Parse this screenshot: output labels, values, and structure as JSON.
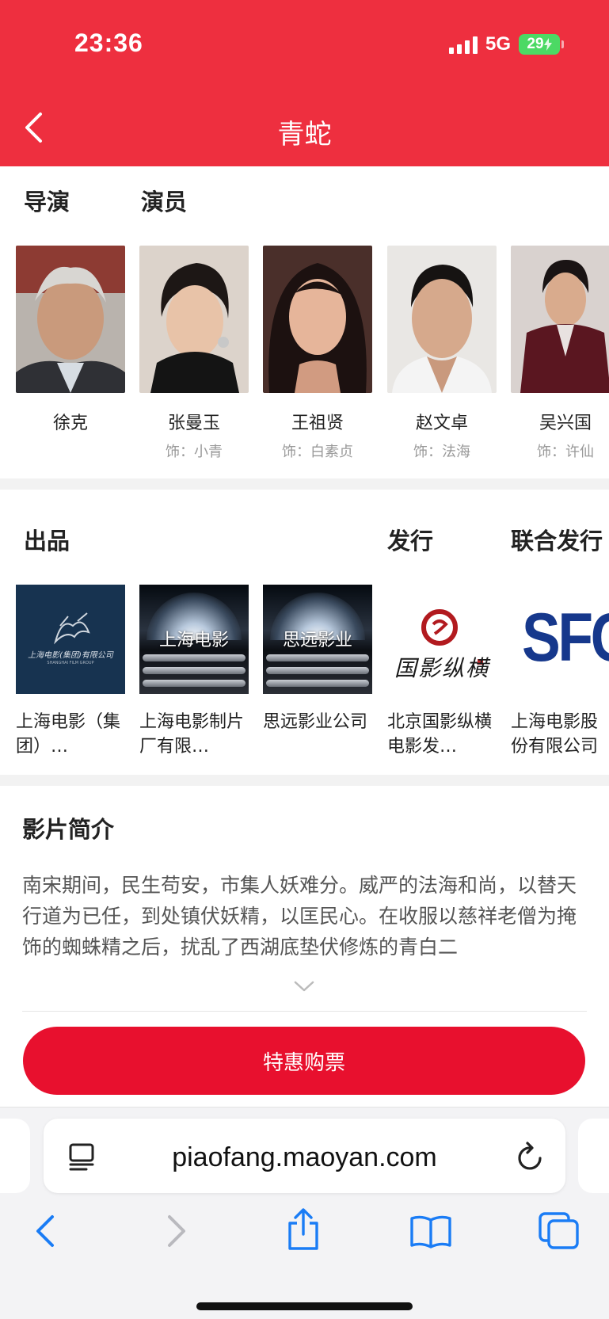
{
  "status_bar": {
    "time": "23:36",
    "network": "5G",
    "battery": "29"
  },
  "header": {
    "title": "青蛇"
  },
  "crew": {
    "tabs": [
      "导演",
      "演员"
    ],
    "people": [
      {
        "name": "徐克",
        "role": ""
      },
      {
        "name": "张曼玉",
        "role": "饰：小青"
      },
      {
        "name": "王祖贤",
        "role": "饰：白素贞"
      },
      {
        "name": "赵文卓",
        "role": "饰：法海"
      },
      {
        "name": "吴兴国",
        "role": "饰：许仙"
      }
    ]
  },
  "companies": {
    "headers": {
      "production": "出品",
      "distribution": "发行",
      "co_distribution": "联合发行"
    },
    "items": [
      {
        "name": "上海电影（集团）…",
        "logo_text": "上海电影(集团)有限公司",
        "logo_sub": "SHANGHAI FILM GROUP"
      },
      {
        "name": "上海电影制片厂有限…",
        "logo_text": "上海电影"
      },
      {
        "name": "思远影业公司",
        "logo_text": "思远影业"
      },
      {
        "name": "北京国影纵横电影发…",
        "logo_text": "国影纵横"
      },
      {
        "name": "上海电影股份有限公司",
        "logo_text": "SFC"
      }
    ]
  },
  "synopsis": {
    "title": "影片简介",
    "text": "南宋期间，民生苟安，市集人妖难分。威严的法海和尚，以替天行道为已任，到处镇伏妖精，以匡民心。在收服以慈祥老僧为掩饰的蜘蛛精之后，扰乱了西湖底垫伏修炼的青白二"
  },
  "buy_button": {
    "label": "特惠购票"
  },
  "browser": {
    "url": "piaofang.maoyan.com"
  },
  "icons": {
    "back": "chevron-left-icon",
    "expand": "chevron-down-icon",
    "reader": "reader-mode-icon",
    "reload": "reload-icon",
    "nav_back": "back-arrow-icon",
    "nav_forward": "forward-arrow-icon",
    "share": "share-icon",
    "bookmarks": "bookmarks-icon",
    "tabs": "tabs-icon"
  },
  "colors": {
    "header": "#ee2f3f",
    "buy_button": "#e8102e",
    "ios_blue": "#1a7cf5"
  }
}
